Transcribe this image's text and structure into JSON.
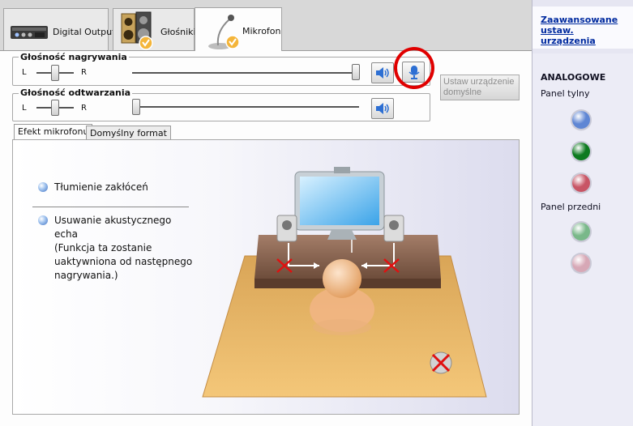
{
  "device_tabs": [
    {
      "label": "Digital Output",
      "icon": "digital-output-device-icon",
      "active": false
    },
    {
      "label": "Głośniki",
      "icon": "speakers-icon",
      "active": false
    },
    {
      "label": "Mikrofon",
      "icon": "microphone-icon",
      "active": true
    }
  ],
  "recording": {
    "title": "Głośność nagrywania",
    "left_label": "L",
    "right_label": "R",
    "balance": 0.5,
    "volume": 1.0
  },
  "playback": {
    "title": "Głośność odtwarzania",
    "left_label": "L",
    "right_label": "R",
    "balance": 0.5,
    "volume": 0.0
  },
  "default_device_button": "Ustaw urządzenie domyślne",
  "sub_tabs": [
    {
      "label": "Efekt mikrofonu",
      "active": true
    },
    {
      "label": "Domyślny format",
      "active": false
    }
  ],
  "effects": {
    "noise_suppression": "Tłumienie zakłóceń",
    "echo_cancellation": "Usuwanie akustycznego echa",
    "echo_note": "(Funkcja ta zostanie uaktywniona od następnego nagrywania.)"
  },
  "right_panel": {
    "advanced_link": "Zaawansowane ustaw. urządzenia",
    "analog_heading": "ANALOGOWE",
    "rear_panel": "Panel tylny",
    "front_panel": "Panel przedni",
    "jack_colors": {
      "rear": [
        "#5f86d4",
        "#0d7a1f",
        "#c85565"
      ],
      "front": [
        "#79b889",
        "#d7a8b6"
      ]
    }
  }
}
